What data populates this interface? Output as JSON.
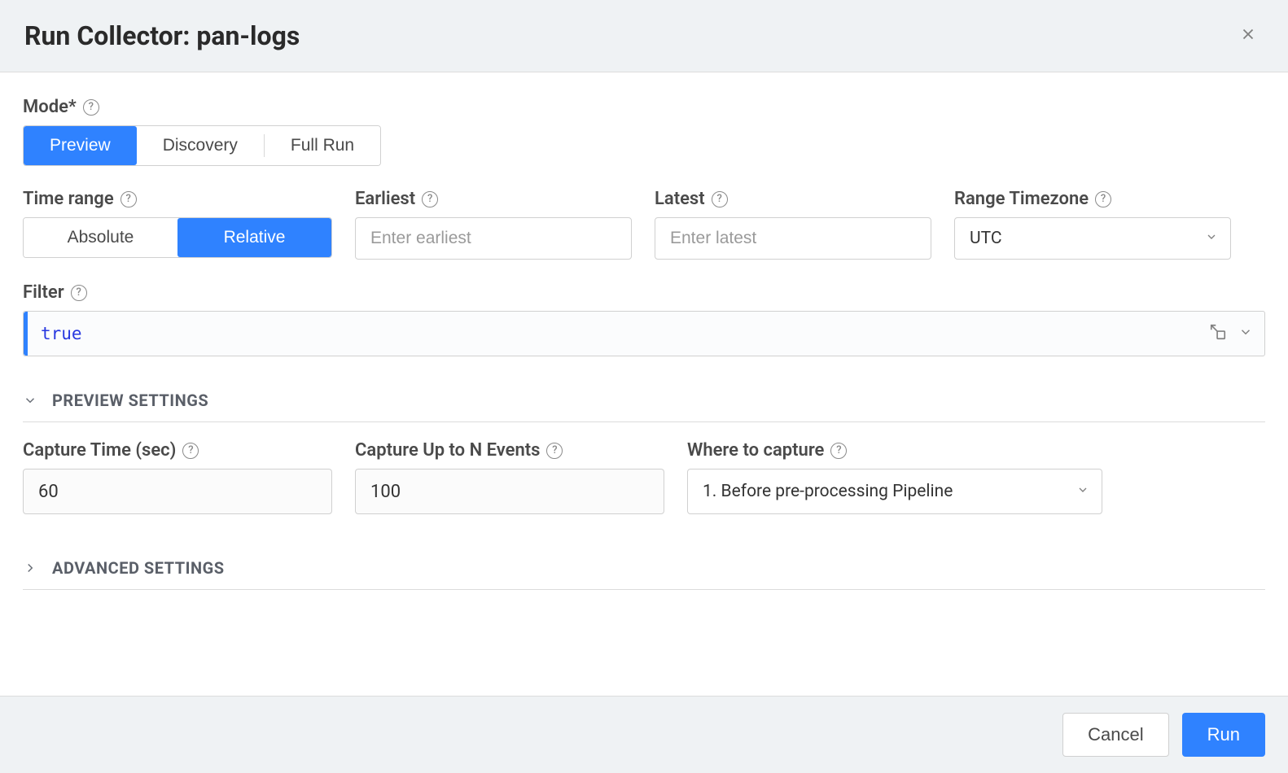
{
  "header": {
    "title": "Run Collector: pan-logs"
  },
  "mode": {
    "label": "Mode*",
    "options": [
      "Preview",
      "Discovery",
      "Full Run"
    ],
    "active": "Preview"
  },
  "time_range": {
    "label": "Time range",
    "options": [
      "Absolute",
      "Relative"
    ],
    "active": "Relative"
  },
  "earliest": {
    "label": "Earliest",
    "placeholder": "Enter earliest",
    "value": ""
  },
  "latest": {
    "label": "Latest",
    "placeholder": "Enter latest",
    "value": ""
  },
  "range_timezone": {
    "label": "Range Timezone",
    "value": "UTC"
  },
  "filter": {
    "label": "Filter",
    "value": "true"
  },
  "sections": {
    "preview_settings": "PREVIEW SETTINGS",
    "advanced_settings": "ADVANCED SETTINGS"
  },
  "capture_time": {
    "label": "Capture Time (sec)",
    "value": "60"
  },
  "capture_events": {
    "label": "Capture Up to N Events",
    "value": "100"
  },
  "where_capture": {
    "label": "Where to capture",
    "value": "1. Before pre-processing Pipeline"
  },
  "footer": {
    "cancel": "Cancel",
    "run": "Run"
  }
}
